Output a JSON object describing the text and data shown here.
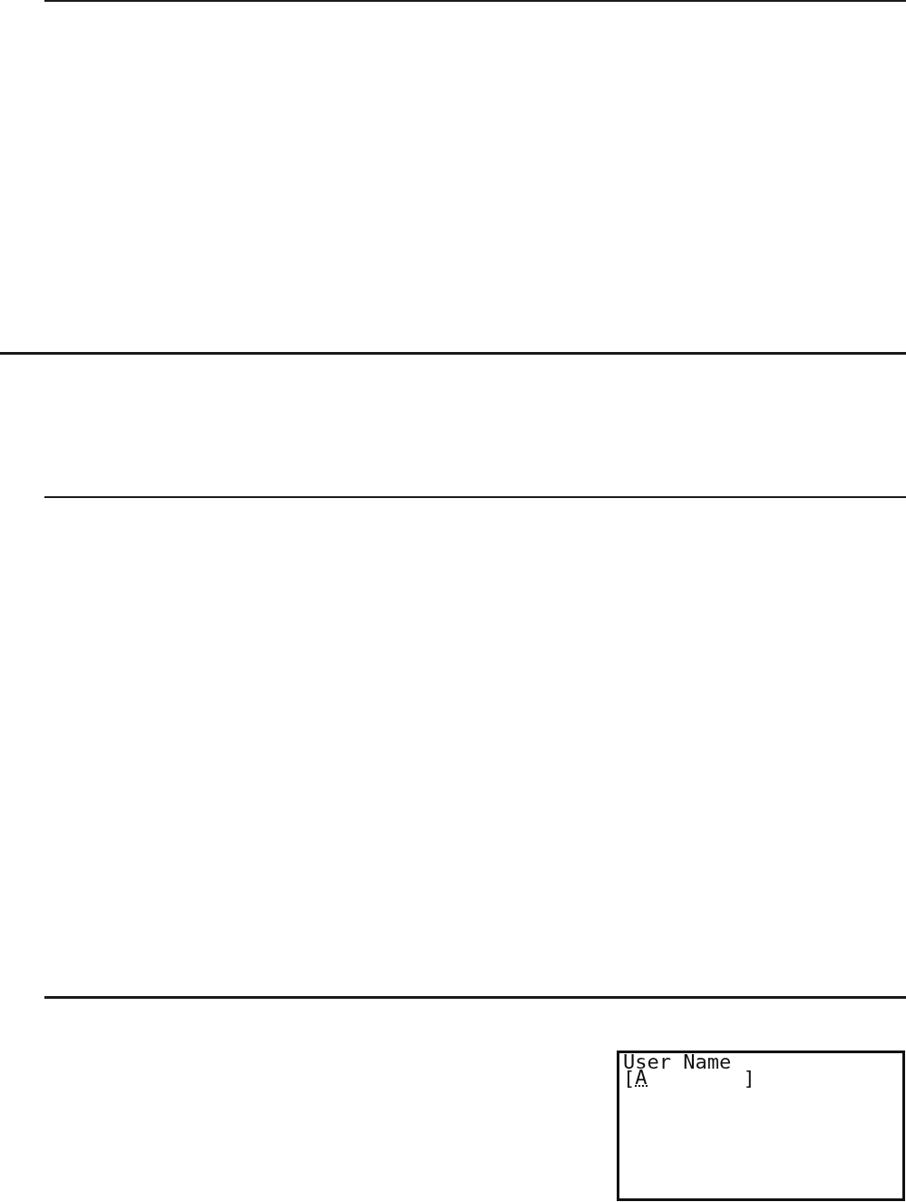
{
  "screen": {
    "title": "User Name",
    "name_field": {
      "open": "[",
      "cursor": "A",
      "close": "]"
    }
  }
}
